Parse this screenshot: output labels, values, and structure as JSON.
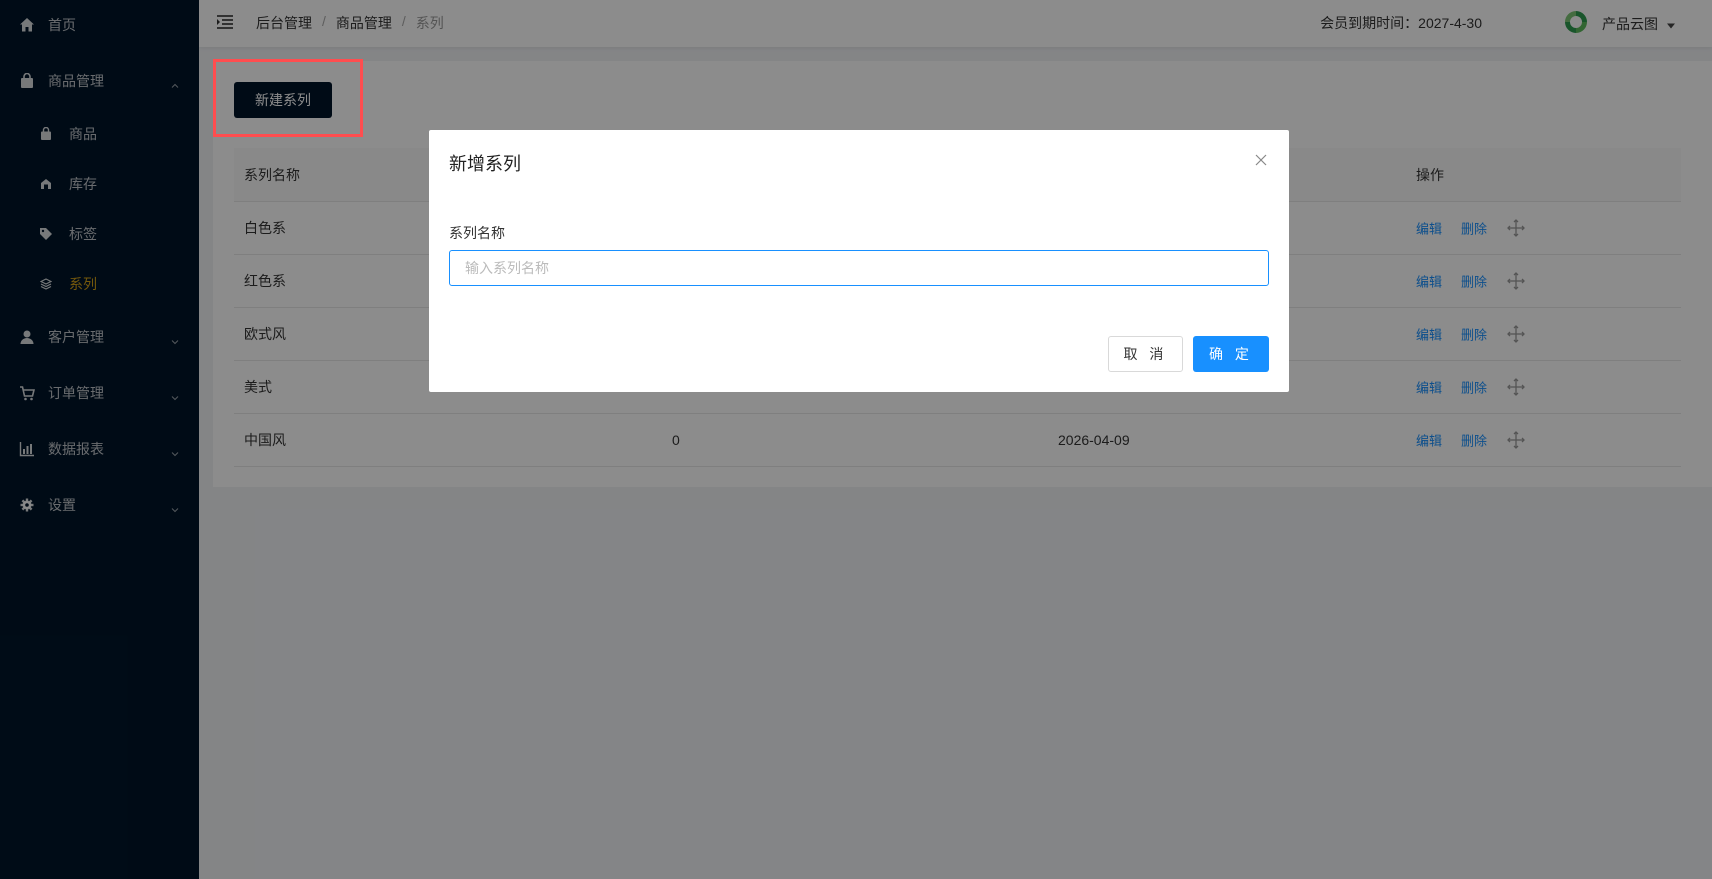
{
  "sidebar": {
    "items": [
      {
        "label": "首页",
        "icon": "home-icon"
      },
      {
        "label": "商品管理",
        "icon": "bag-icon",
        "expanded": true
      },
      {
        "label": "客户管理",
        "icon": "user-icon"
      },
      {
        "label": "订单管理",
        "icon": "cart-icon"
      },
      {
        "label": "数据报表",
        "icon": "chart-icon"
      },
      {
        "label": "设置",
        "icon": "gear-icon"
      }
    ],
    "subitems": [
      {
        "label": "商品",
        "icon": "bag-icon"
      },
      {
        "label": "库存",
        "icon": "warehouse-icon"
      },
      {
        "label": "标签",
        "icon": "tag-icon"
      },
      {
        "label": "系列",
        "icon": "layers-icon",
        "active": true
      }
    ]
  },
  "header": {
    "breadcrumb": [
      "后台管理",
      "商品管理",
      "系列"
    ],
    "member_label": "会员到期时间：",
    "member_date": "2027-4-30",
    "username": "产品云图"
  },
  "content": {
    "new_button": "新建系列",
    "columns": [
      "系列名称",
      "操作"
    ],
    "rows": [
      {
        "name": "白色系"
      },
      {
        "name": "红色系"
      },
      {
        "name": "欧式风"
      },
      {
        "name": "美式"
      },
      {
        "name": "中国风",
        "count": "0",
        "date": "2026-04-09"
      }
    ],
    "actions": {
      "edit": "编辑",
      "delete": "删除"
    }
  },
  "modal": {
    "title": "新增系列",
    "field_label": "系列名称",
    "field_placeholder": "输入系列名称",
    "field_value": "",
    "cancel": "取 消",
    "ok": "确 定"
  },
  "colors": {
    "sidebar": "#001529",
    "primary": "#1890ff",
    "active": "#d4a017",
    "highlight": "#ff4d4f"
  }
}
